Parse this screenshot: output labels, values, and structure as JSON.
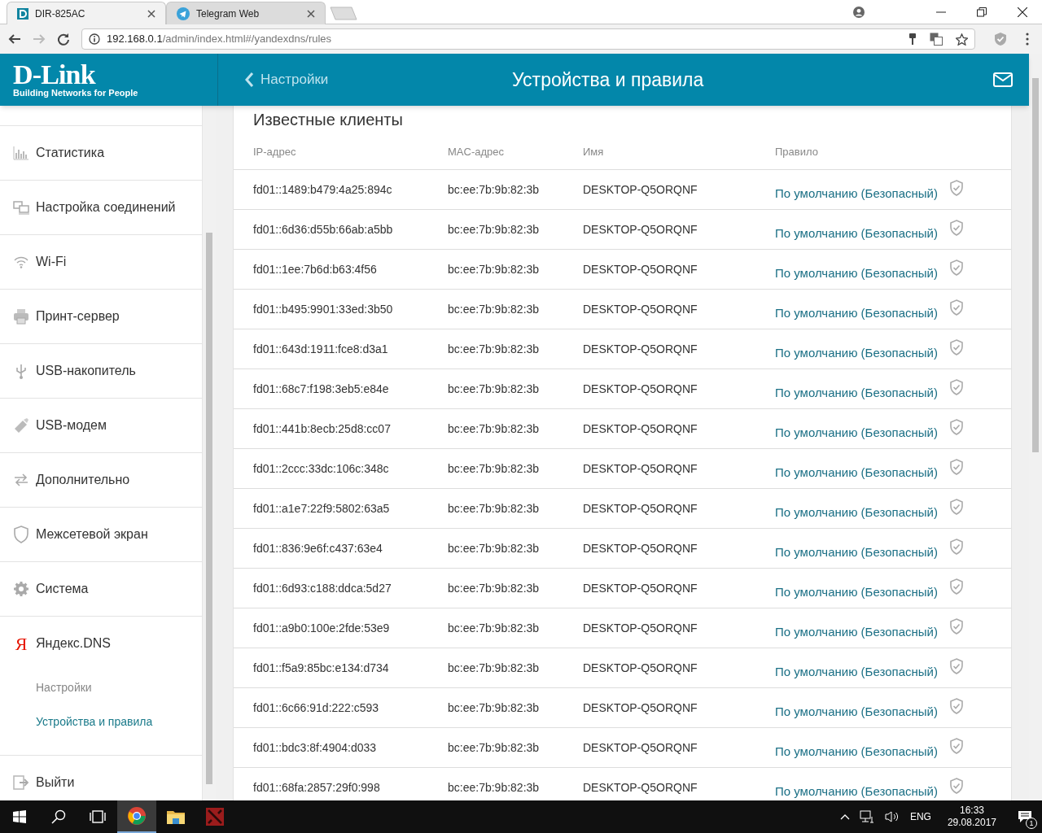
{
  "browser": {
    "tabs": [
      {
        "title": "DIR-825AC",
        "selected": true
      },
      {
        "title": "Telegram Web",
        "selected": false
      }
    ],
    "url": {
      "host": "192.168.0.1",
      "path": "/admin/index.html#/yandexdns/rules"
    }
  },
  "header": {
    "logo": "D-Link",
    "tagline": "Building Networks for People",
    "back": "Настройки",
    "title": "Устройства и правила"
  },
  "sidebar": {
    "items": [
      {
        "label": "Статистика"
      },
      {
        "label": "Настройка соединений"
      },
      {
        "label": "Wi-Fi"
      },
      {
        "label": "Принт-сервер"
      },
      {
        "label": "USB-накопитель"
      },
      {
        "label": "USB-модем"
      },
      {
        "label": "Дополнительно"
      },
      {
        "label": "Межсетевой экран"
      },
      {
        "label": "Система"
      },
      {
        "label": "Яндекс.DNS",
        "icon_text": "Я",
        "children": [
          {
            "label": "Настройки",
            "selected": false
          },
          {
            "label": "Устройства и правила",
            "selected": true
          }
        ]
      },
      {
        "label": "Выйти"
      }
    ]
  },
  "section": {
    "title": "Известные клиенты",
    "table": {
      "columns": [
        "IP-адрес",
        "MAC-адрес",
        "Имя",
        "Правило"
      ],
      "rows": [
        {
          "ip": "fd01::1489:b479:4a25:894c",
          "mac": "bc:ee:7b:9b:82:3b",
          "name": "DESKTOP-Q5ORQNF",
          "rule": "По умолчанию (Безопасный)"
        },
        {
          "ip": "fd01::6d36:d55b:66ab:a5bb",
          "mac": "bc:ee:7b:9b:82:3b",
          "name": "DESKTOP-Q5ORQNF",
          "rule": "По умолчанию (Безопасный)"
        },
        {
          "ip": "fd01::1ee:7b6d:b63:4f56",
          "mac": "bc:ee:7b:9b:82:3b",
          "name": "DESKTOP-Q5ORQNF",
          "rule": "По умолчанию (Безопасный)"
        },
        {
          "ip": "fd01::b495:9901:33ed:3b50",
          "mac": "bc:ee:7b:9b:82:3b",
          "name": "DESKTOP-Q5ORQNF",
          "rule": "По умолчанию (Безопасный)"
        },
        {
          "ip": "fd01::643d:1911:fce8:d3a1",
          "mac": "bc:ee:7b:9b:82:3b",
          "name": "DESKTOP-Q5ORQNF",
          "rule": "По умолчанию (Безопасный)"
        },
        {
          "ip": "fd01::68c7:f198:3eb5:e84e",
          "mac": "bc:ee:7b:9b:82:3b",
          "name": "DESKTOP-Q5ORQNF",
          "rule": "По умолчанию (Безопасный)"
        },
        {
          "ip": "fd01::441b:8ecb:25d8:cc07",
          "mac": "bc:ee:7b:9b:82:3b",
          "name": "DESKTOP-Q5ORQNF",
          "rule": "По умолчанию (Безопасный)"
        },
        {
          "ip": "fd01::2ccc:33dc:106c:348c",
          "mac": "bc:ee:7b:9b:82:3b",
          "name": "DESKTOP-Q5ORQNF",
          "rule": "По умолчанию (Безопасный)"
        },
        {
          "ip": "fd01::a1e7:22f9:5802:63a5",
          "mac": "bc:ee:7b:9b:82:3b",
          "name": "DESKTOP-Q5ORQNF",
          "rule": "По умолчанию (Безопасный)"
        },
        {
          "ip": "fd01::836:9e6f:c437:63e4",
          "mac": "bc:ee:7b:9b:82:3b",
          "name": "DESKTOP-Q5ORQNF",
          "rule": "По умолчанию (Безопасный)"
        },
        {
          "ip": "fd01::6d93:c188:ddca:5d27",
          "mac": "bc:ee:7b:9b:82:3b",
          "name": "DESKTOP-Q5ORQNF",
          "rule": "По умолчанию (Безопасный)"
        },
        {
          "ip": "fd01::a9b0:100e:2fde:53e9",
          "mac": "bc:ee:7b:9b:82:3b",
          "name": "DESKTOP-Q5ORQNF",
          "rule": "По умолчанию (Безопасный)"
        },
        {
          "ip": "fd01::f5a9:85bc:e134:d734",
          "mac": "bc:ee:7b:9b:82:3b",
          "name": "DESKTOP-Q5ORQNF",
          "rule": "По умолчанию (Безопасный)"
        },
        {
          "ip": "fd01::6c66:91d:222:c593",
          "mac": "bc:ee:7b:9b:82:3b",
          "name": "DESKTOP-Q5ORQNF",
          "rule": "По умолчанию (Безопасный)"
        },
        {
          "ip": "fd01::bdc3:8f:4904:d033",
          "mac": "bc:ee:7b:9b:82:3b",
          "name": "DESKTOP-Q5ORQNF",
          "rule": "По умолчанию (Безопасный)"
        },
        {
          "ip": "fd01::68fa:2857:29f0:998",
          "mac": "bc:ee:7b:9b:82:3b",
          "name": "DESKTOP-Q5ORQNF",
          "rule": "По умолчанию (Безопасный)"
        }
      ]
    }
  },
  "taskbar": {
    "language": "ENG",
    "time": "16:33",
    "date": "29.08.2017",
    "notifications": "1"
  }
}
